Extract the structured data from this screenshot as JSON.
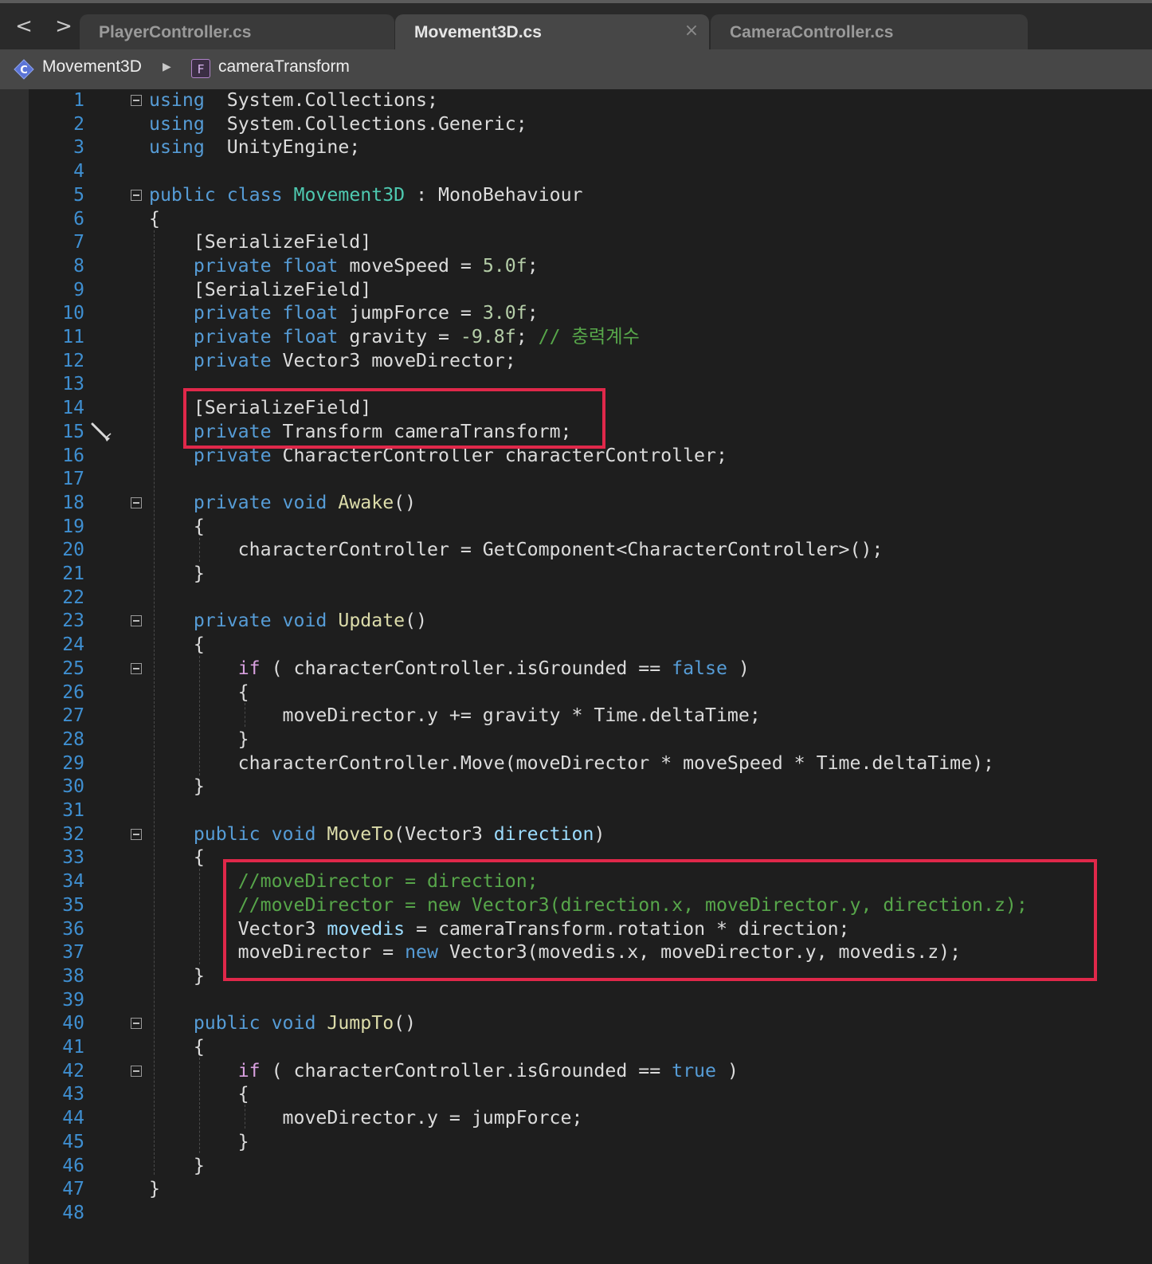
{
  "nav": {
    "back_glyph": "<",
    "forward_glyph": ">"
  },
  "tabs": [
    {
      "label": "PlayerController.cs",
      "active": false
    },
    {
      "label": "Movement3D.cs",
      "active": true,
      "close_glyph": "×"
    },
    {
      "label": "CameraController.cs",
      "active": false
    }
  ],
  "breadcrumb": {
    "class_icon": "class-icon",
    "class_name": "Movement3D",
    "separator": "▶",
    "field_icon_letter": "F",
    "field_name": "cameraTransform"
  },
  "editor": {
    "line_numbers": [
      "1",
      "2",
      "3",
      "4",
      "5",
      "6",
      "7",
      "8",
      "9",
      "10",
      "11",
      "12",
      "13",
      "14",
      "15",
      "16",
      "17",
      "18",
      "19",
      "20",
      "21",
      "22",
      "23",
      "24",
      "25",
      "26",
      "27",
      "28",
      "29",
      "30",
      "31",
      "32",
      "33",
      "34",
      "35",
      "36",
      "37",
      "38",
      "39",
      "40",
      "41",
      "42",
      "43",
      "44",
      "45",
      "46",
      "47",
      "48"
    ],
    "lines": [
      [
        [
          "k",
          "using"
        ],
        [
          "",
          "  System.Collections;"
        ]
      ],
      [
        [
          "k",
          "using"
        ],
        [
          "",
          "  System.Collections.Generic;"
        ]
      ],
      [
        [
          "k",
          "using"
        ],
        [
          "",
          "  UnityEngine;"
        ]
      ],
      [],
      [
        [
          "k",
          "public"
        ],
        [
          "",
          " "
        ],
        [
          "k",
          "class"
        ],
        [
          "",
          " "
        ],
        [
          "t",
          "Movement3D"
        ],
        [
          "",
          " : MonoBehaviour"
        ]
      ],
      [
        [
          "",
          "{"
        ]
      ],
      [
        [
          "",
          "    [SerializeField]"
        ]
      ],
      [
        [
          "",
          "    "
        ],
        [
          "k",
          "private"
        ],
        [
          "",
          " "
        ],
        [
          "k",
          "float"
        ],
        [
          "",
          " moveSpeed = "
        ],
        [
          "n",
          "5.0f"
        ],
        [
          "",
          ";"
        ]
      ],
      [
        [
          "",
          "    [SerializeField]"
        ]
      ],
      [
        [
          "",
          "    "
        ],
        [
          "k",
          "private"
        ],
        [
          "",
          " "
        ],
        [
          "k",
          "float"
        ],
        [
          "",
          " jumpForce = "
        ],
        [
          "n",
          "3.0f"
        ],
        [
          "",
          ";"
        ]
      ],
      [
        [
          "",
          "    "
        ],
        [
          "k",
          "private"
        ],
        [
          "",
          " "
        ],
        [
          "k",
          "float"
        ],
        [
          "",
          " gravity = "
        ],
        [
          "n",
          "-9.8f"
        ],
        [
          "",
          "; "
        ],
        [
          "c",
          "// 충력계수"
        ]
      ],
      [
        [
          "",
          "    "
        ],
        [
          "k",
          "private"
        ],
        [
          "",
          " Vector3 moveDirector;"
        ]
      ],
      [],
      [
        [
          "",
          "    [SerializeField]"
        ]
      ],
      [
        [
          "",
          "    "
        ],
        [
          "k",
          "private"
        ],
        [
          "",
          " Transform cameraTransform;"
        ]
      ],
      [
        [
          "",
          "    "
        ],
        [
          "k",
          "private"
        ],
        [
          "",
          " CharacterController characterController;"
        ]
      ],
      [],
      [
        [
          "",
          "    "
        ],
        [
          "k",
          "private"
        ],
        [
          "",
          " "
        ],
        [
          "k",
          "void"
        ],
        [
          "",
          " "
        ],
        [
          "m",
          "Awake"
        ],
        [
          "",
          "()"
        ]
      ],
      [
        [
          "",
          "    {"
        ]
      ],
      [
        [
          "",
          "        characterController = GetComponent<CharacterController>();"
        ]
      ],
      [
        [
          "",
          "    }"
        ]
      ],
      [],
      [
        [
          "",
          "    "
        ],
        [
          "k",
          "private"
        ],
        [
          "",
          " "
        ],
        [
          "k",
          "void"
        ],
        [
          "",
          " "
        ],
        [
          "m",
          "Update"
        ],
        [
          "",
          "()"
        ]
      ],
      [
        [
          "",
          "    {"
        ]
      ],
      [
        [
          "",
          "        "
        ],
        [
          "ct",
          "if"
        ],
        [
          "",
          " ( characterController.isGrounded == "
        ],
        [
          "k",
          "false"
        ],
        [
          "",
          " )"
        ]
      ],
      [
        [
          "",
          "        {"
        ]
      ],
      [
        [
          "",
          "            moveDirector.y += gravity * Time.deltaTime;"
        ]
      ],
      [
        [
          "",
          "        }"
        ]
      ],
      [
        [
          "",
          "        characterController.Move(moveDirector * moveSpeed * Time.deltaTime);"
        ]
      ],
      [
        [
          "",
          "    }"
        ]
      ],
      [],
      [
        [
          "",
          "    "
        ],
        [
          "k",
          "public"
        ],
        [
          "",
          " "
        ],
        [
          "k",
          "void"
        ],
        [
          "",
          " "
        ],
        [
          "m",
          "MoveTo"
        ],
        [
          "",
          "(Vector3 "
        ],
        [
          "p",
          "direction"
        ],
        [
          "",
          ")"
        ]
      ],
      [
        [
          "",
          "    {"
        ]
      ],
      [
        [
          "",
          "        "
        ],
        [
          "c",
          "//moveDirector = direction;"
        ]
      ],
      [
        [
          "",
          "        "
        ],
        [
          "c",
          "//moveDirector = new Vector3(direction.x, moveDirector.y, direction.z);"
        ]
      ],
      [
        [
          "",
          "        Vector3 "
        ],
        [
          "v",
          "movedis"
        ],
        [
          "",
          " = cameraTransform.rotation * direction;"
        ]
      ],
      [
        [
          "",
          "        moveDirector = "
        ],
        [
          "k",
          "new"
        ],
        [
          "",
          " Vector3(movedis.x, moveDirector.y, movedis.z);"
        ]
      ],
      [
        [
          "",
          "    }"
        ]
      ],
      [],
      [
        [
          "",
          "    "
        ],
        [
          "k",
          "public"
        ],
        [
          "",
          " "
        ],
        [
          "k",
          "void"
        ],
        [
          "",
          " "
        ],
        [
          "m",
          "JumpTo"
        ],
        [
          "",
          "()"
        ]
      ],
      [
        [
          "",
          "    {"
        ]
      ],
      [
        [
          "",
          "        "
        ],
        [
          "ct",
          "if"
        ],
        [
          "",
          " ( characterController.isGrounded == "
        ],
        [
          "k",
          "true"
        ],
        [
          "",
          " )"
        ]
      ],
      [
        [
          "",
          "        {"
        ]
      ],
      [
        [
          "",
          "            moveDirector.y = jumpForce;"
        ]
      ],
      [
        [
          "",
          "        }"
        ]
      ],
      [
        [
          "",
          "    }"
        ]
      ],
      [
        [
          "",
          "}"
        ]
      ],
      []
    ],
    "fold_markers_on_lines": [
      1,
      5,
      18,
      23,
      25,
      32,
      40,
      42
    ],
    "gutter_icon": "pen-icon",
    "highlight_color": "#e0284a"
  }
}
